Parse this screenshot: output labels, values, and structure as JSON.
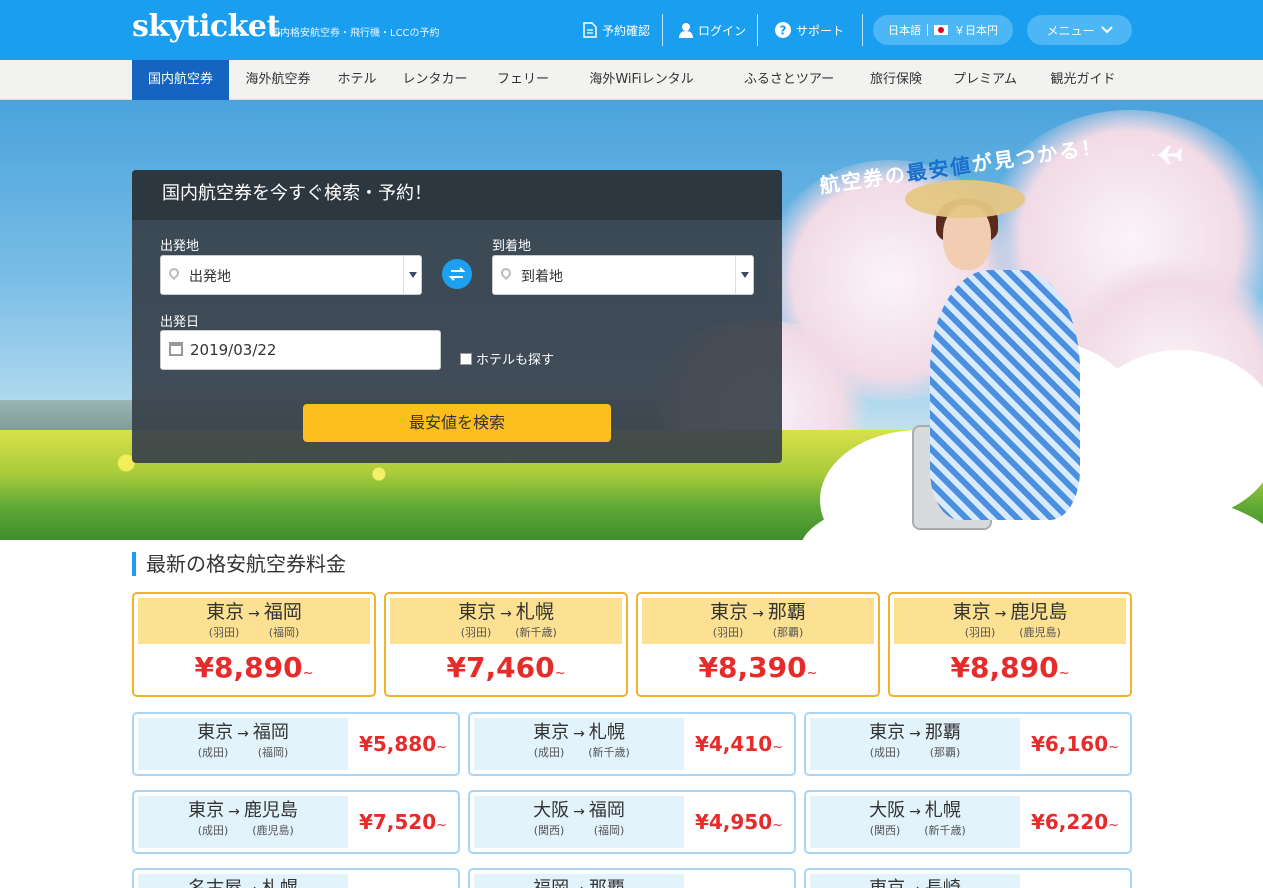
{
  "header": {
    "logo": "skyticket",
    "tagline": "国内格安航空券・飛行機・LCCの予約",
    "nav": {
      "booking": "予約確認",
      "login": "ログイン",
      "support": "サポート"
    },
    "locale": {
      "language": "日本語",
      "currency": "￥日本円"
    },
    "menu": "メニュー"
  },
  "subnav": [
    "国内航空券",
    "海外航空券",
    "ホテル",
    "レンタカー",
    "フェリー",
    "海外WiFiレンタル",
    "ふるさとツアー",
    "旅行保険",
    "プレミアム",
    "観光ガイド"
  ],
  "search": {
    "heading": "国内航空券を今すぐ検索・予約！",
    "origin_label": "出発地",
    "origin_placeholder": "出発地",
    "destination_label": "到着地",
    "destination_placeholder": "到着地",
    "date_label": "出発日",
    "date_value": "2019/03/22",
    "hotel_checkbox": "ホテルも探す",
    "hotel_checked": false,
    "submit": "最安値を検索"
  },
  "promo": {
    "text_before": "航空券の",
    "text_highlight": "最安値",
    "text_after": "が見つかる！"
  },
  "fares": {
    "title": "最新の格安航空券料金",
    "featured": [
      {
        "from": "東京",
        "to": "福岡",
        "from_airport": "(羽田)",
        "to_airport": "(福岡)",
        "price": "¥8,890",
        "suffix": "~"
      },
      {
        "from": "東京",
        "to": "札幌",
        "from_airport": "(羽田)",
        "to_airport": "(新千歳)",
        "price": "¥7,460",
        "suffix": "~"
      },
      {
        "from": "東京",
        "to": "那覇",
        "from_airport": "(羽田)",
        "to_airport": "(那覇)",
        "price": "¥8,390",
        "suffix": "~"
      },
      {
        "from": "東京",
        "to": "鹿児島",
        "from_airport": "(羽田)",
        "to_airport": "(鹿児島)",
        "price": "¥8,890",
        "suffix": "~"
      }
    ],
    "list": [
      {
        "from": "東京",
        "to": "福岡",
        "from_airport": "(成田)",
        "to_airport": "(福岡)",
        "price": "¥5,880",
        "suffix": "~"
      },
      {
        "from": "東京",
        "to": "札幌",
        "from_airport": "(成田)",
        "to_airport": "(新千歳)",
        "price": "¥4,410",
        "suffix": "~"
      },
      {
        "from": "東京",
        "to": "那覇",
        "from_airport": "(成田)",
        "to_airport": "(那覇)",
        "price": "¥6,160",
        "suffix": "~"
      },
      {
        "from": "東京",
        "to": "鹿児島",
        "from_airport": "(成田)",
        "to_airport": "(鹿児島)",
        "price": "¥7,520",
        "suffix": "~"
      },
      {
        "from": "大阪",
        "to": "福岡",
        "from_airport": "(関西)",
        "to_airport": "(福岡)",
        "price": "¥4,950",
        "suffix": "~"
      },
      {
        "from": "大阪",
        "to": "札幌",
        "from_airport": "(関西)",
        "to_airport": "(新千歳)",
        "price": "¥6,220",
        "suffix": "~"
      },
      {
        "from": "名古屋",
        "to": "札幌",
        "from_airport": "",
        "to_airport": "",
        "price": "",
        "suffix": ""
      },
      {
        "from": "福岡",
        "to": "那覇",
        "from_airport": "",
        "to_airport": "",
        "price": "",
        "suffix": ""
      },
      {
        "from": "東京",
        "to": "長崎",
        "from_airport": "",
        "to_airport": "",
        "price": "",
        "suffix": ""
      }
    ]
  },
  "icons": [
    "document-icon",
    "user-icon",
    "question-icon",
    "flag-japan-icon",
    "chevron-down-icon",
    "location-pin-icon",
    "swap-icon",
    "calendar-icon",
    "airplane-icon"
  ],
  "colors": {
    "header_blue": "#1a9ff0",
    "active_tab": "#1565c0",
    "search_button": "#fcbf1e",
    "price_red": "#e62b2b",
    "featured_border": "#f0b32b"
  }
}
